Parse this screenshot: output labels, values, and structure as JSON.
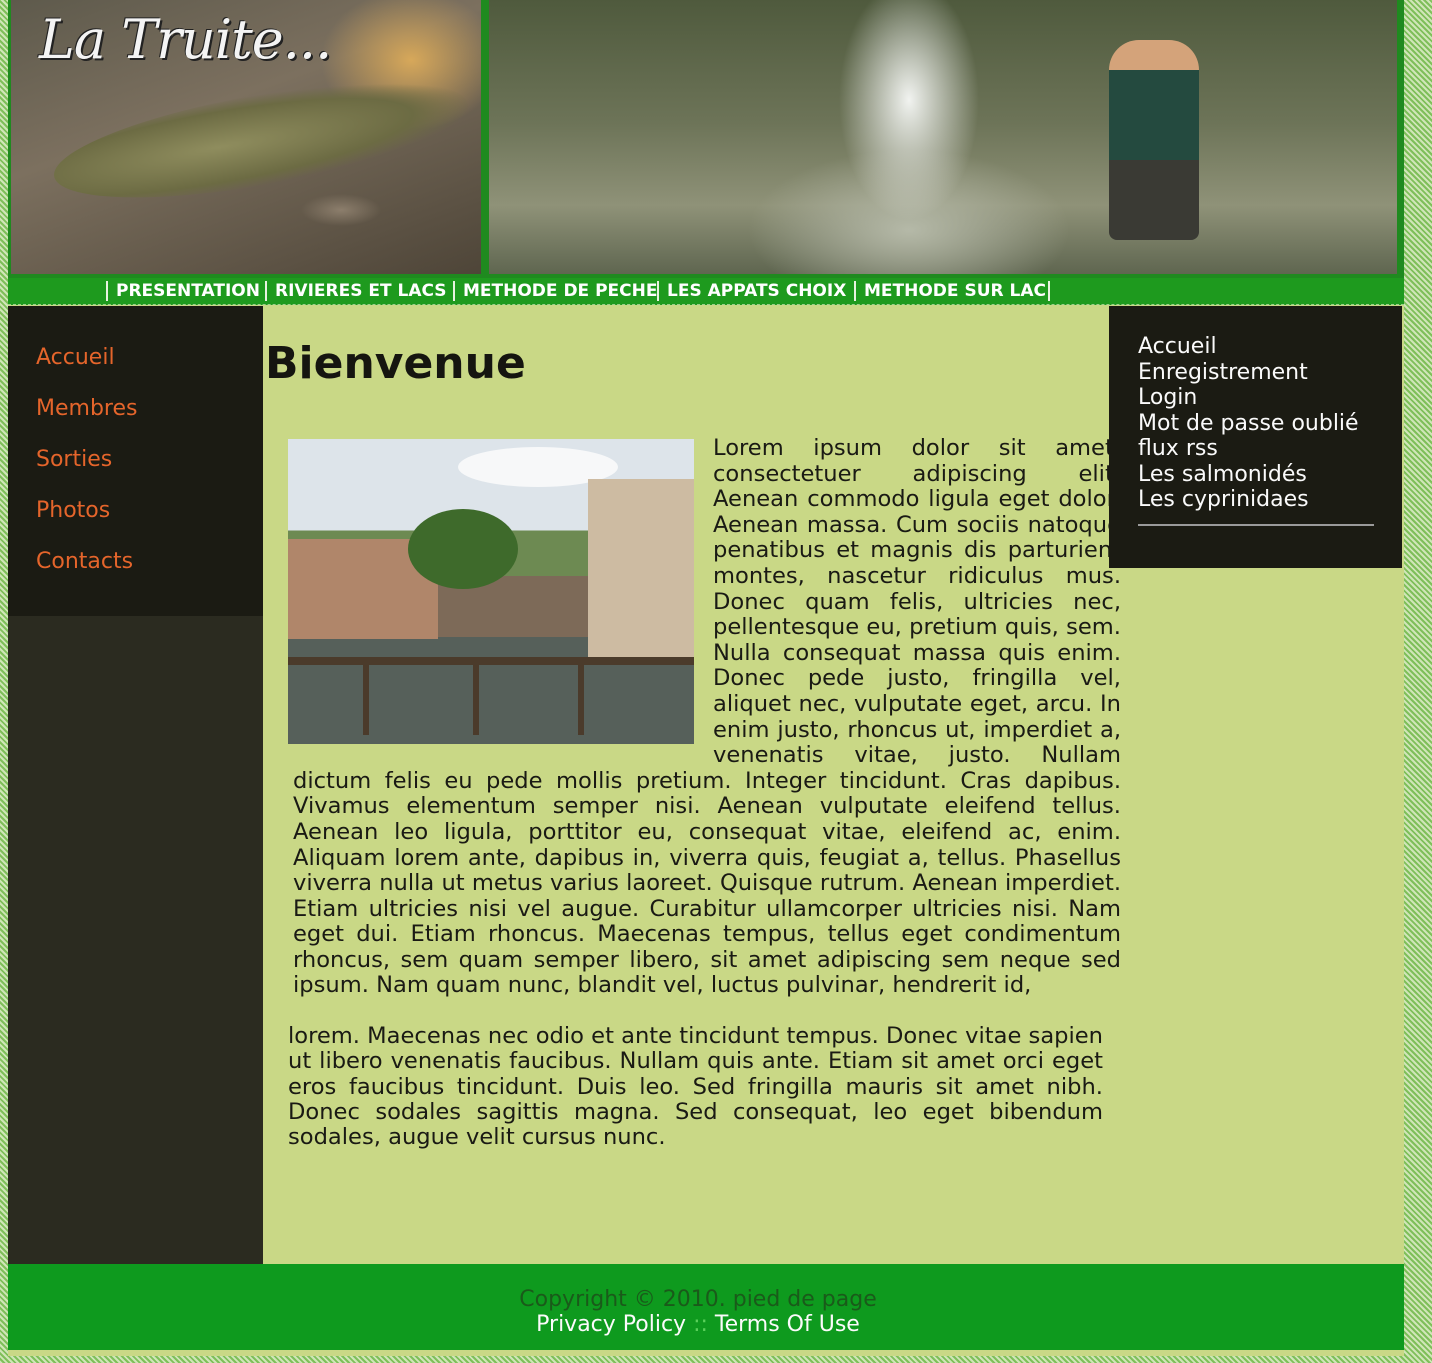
{
  "header": {
    "logo_text": "La Truite..."
  },
  "topnav": {
    "items": [
      "PRESENTATION",
      "RIVIERES ET LACS",
      "METHODE DE PECHE",
      "LES APPATS CHOIX",
      "METHODE SUR LAC"
    ]
  },
  "leftnav": {
    "items": [
      "Accueil",
      "Membres",
      "Sorties",
      "Photos",
      "Contacts"
    ]
  },
  "main": {
    "title": "Bienvenue",
    "paragraph1": "Lorem ipsum dolor sit amet, consectetuer adipiscing elit. Aenean commodo ligula eget dolor. Aenean massa. Cum sociis natoque penatibus et magnis dis parturient montes, nascetur ridiculus mus. Donec quam felis, ultricies nec, pellentesque eu, pretium quis, sem. Nulla consequat massa quis enim. Donec pede justo, fringilla vel, aliquet nec, vulputate eget, arcu. In enim justo, rhoncus ut, imperdiet a, venenatis vitae, justo. Nullam dictum felis eu pede mollis pretium. Integer tincidunt. Cras dapibus. Vivamus elementum semper nisi. Aenean vulputate eleifend tellus. Aenean leo ligula, porttitor eu, consequat vitae, eleifend ac, enim. Aliquam lorem ante, dapibus in, viverra quis, feugiat a, tellus. Phasellus viverra nulla ut metus varius laoreet. Quisque rutrum. Aenean imperdiet. Etiam ultricies nisi vel augue. Curabitur ullamcorper ultricies nisi. Nam eget dui. Etiam rhoncus. Maecenas tempus, tellus eget condimentum rhoncus, sem quam semper libero, sit amet adipiscing sem neque sed ipsum. Nam quam nunc, blandit vel, luctus pulvinar, hendrerit id,",
    "paragraph2": "lorem. Maecenas nec odio et ante tincidunt tempus. Donec vitae sapien ut libero venenatis faucibus. Nullam quis ante. Etiam sit amet orci eget eros faucibus tincidunt. Duis leo. Sed fringilla mauris sit amet nibh. Donec sodales sagittis magna. Sed consequat, leo eget bibendum sodales, augue velit cursus nunc."
  },
  "rightnav": {
    "items": [
      "Accueil",
      "Enregistrement",
      "Login",
      "Mot de passe oublié",
      "flux rss",
      "Les salmonidés",
      "Les cyprinidaes"
    ]
  },
  "footer": {
    "copyright": "Copyright © 2010. pied de page",
    "privacy": "Privacy Policy",
    "separator": "::",
    "terms": "Terms Of Use"
  },
  "colors": {
    "page_bg": "#c9d886",
    "nav_green": "#1e9a1e",
    "sidebar_dark": "#1b1b13",
    "link_orange": "#e5652b"
  }
}
